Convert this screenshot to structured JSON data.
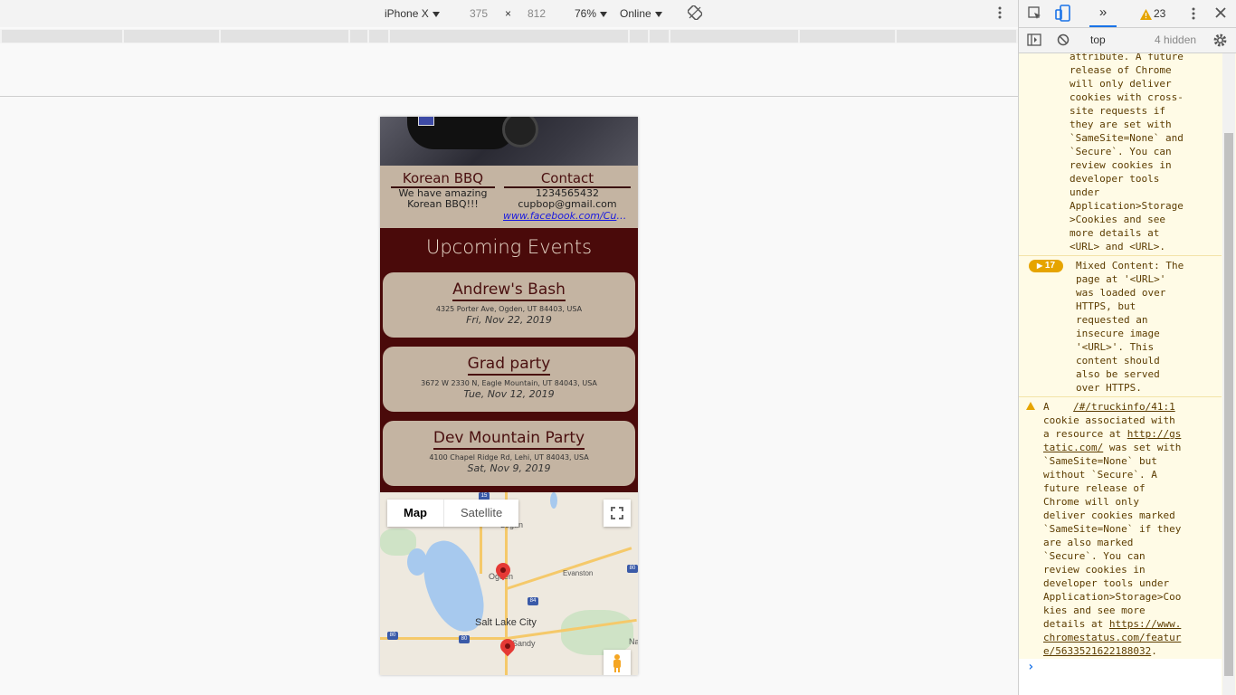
{
  "device_toolbar": {
    "device": "iPhone X",
    "width": "375",
    "times": "×",
    "height": "812",
    "zoom": "76%",
    "network": "Online"
  },
  "devtools": {
    "more_tabs": "»",
    "warning_count": "23",
    "context": "top",
    "hidden": "4 hidden",
    "messages": [
      {
        "lines": [
          "attribute. A future",
          "release of Chrome",
          "will only deliver",
          "cookies with cross-",
          "site requests if",
          "they are set with",
          "`SameSite=None` and",
          "`Secure`. You can",
          "review cookies in",
          "developer tools",
          "under",
          "Application>Storage",
          ">Cookies and see",
          "more details at",
          "<URL> and <URL>."
        ]
      },
      {
        "count": "17",
        "lines": [
          "Mixed Content: The",
          "page at '<URL>'",
          "was loaded over",
          "HTTPS, but",
          "requested an",
          "insecure image",
          "'<URL>'. This",
          "content should",
          "also be served",
          "over HTTPS."
        ]
      },
      {
        "source": "/#/truckinfo/41:1",
        "lines_a": [
          "A",
          "cookie associated with",
          "a resource at "
        ],
        "link1a": "http://gs",
        "link1b": "tatic.com/",
        "after_link1": " was set with",
        "lines_b": [
          "`SameSite=None` but",
          "without `Secure`. A",
          "future release of",
          "Chrome will only",
          "deliver cookies marked",
          "`SameSite=None` if they",
          "are also marked",
          "`Secure`. You can",
          "review cookies in",
          "developer tools under",
          "Application>Storage>Coo",
          "kies and see more",
          "details at "
        ],
        "link2a": "https://www.",
        "link2b": "chromestatus.com/featur",
        "link2c": "e/5633521622188032",
        "end": "."
      }
    ],
    "prompt": "›"
  },
  "site": {
    "info": {
      "about_title": "Korean BBQ",
      "about_lines": [
        "We have amazing",
        "Korean BBQ!!!"
      ],
      "contact_title": "Contact",
      "phone": "1234565432",
      "email": "cupbop@gmail.com",
      "facebook": "www.facebook.com/Cupbop"
    },
    "events_title": "Upcoming Events",
    "events": [
      {
        "name": "Andrew's Bash",
        "address": "4325 Porter Ave, Ogden, UT 84403, USA",
        "date": "Fri, Nov 22, 2019"
      },
      {
        "name": "Grad party",
        "address": "3672 W 2330 N, Eagle Mountain, UT 84043, USA",
        "date": "Tue, Nov 12, 2019"
      },
      {
        "name": "Dev Mountain Party",
        "address": "4100 Chapel Ridge Rd, Lehi, UT 84043, USA",
        "date": "Sat, Nov 9, 2019"
      }
    ],
    "map": {
      "type_map": "Map",
      "type_satellite": "Satellite",
      "labels": {
        "logan": "Logan",
        "ogden": "Ogden",
        "evanston": "Evanston",
        "slc": "Salt Lake City",
        "sandy": "Sandy",
        "na": "Na"
      },
      "shields": {
        "i15": "15",
        "i84": "84",
        "i80a": "80",
        "i80b": "80",
        "i80c": "80"
      }
    }
  },
  "colors": {
    "maroon": "#4a0a0a",
    "tan": "#c4b4a2",
    "warning": "#e6a400"
  }
}
